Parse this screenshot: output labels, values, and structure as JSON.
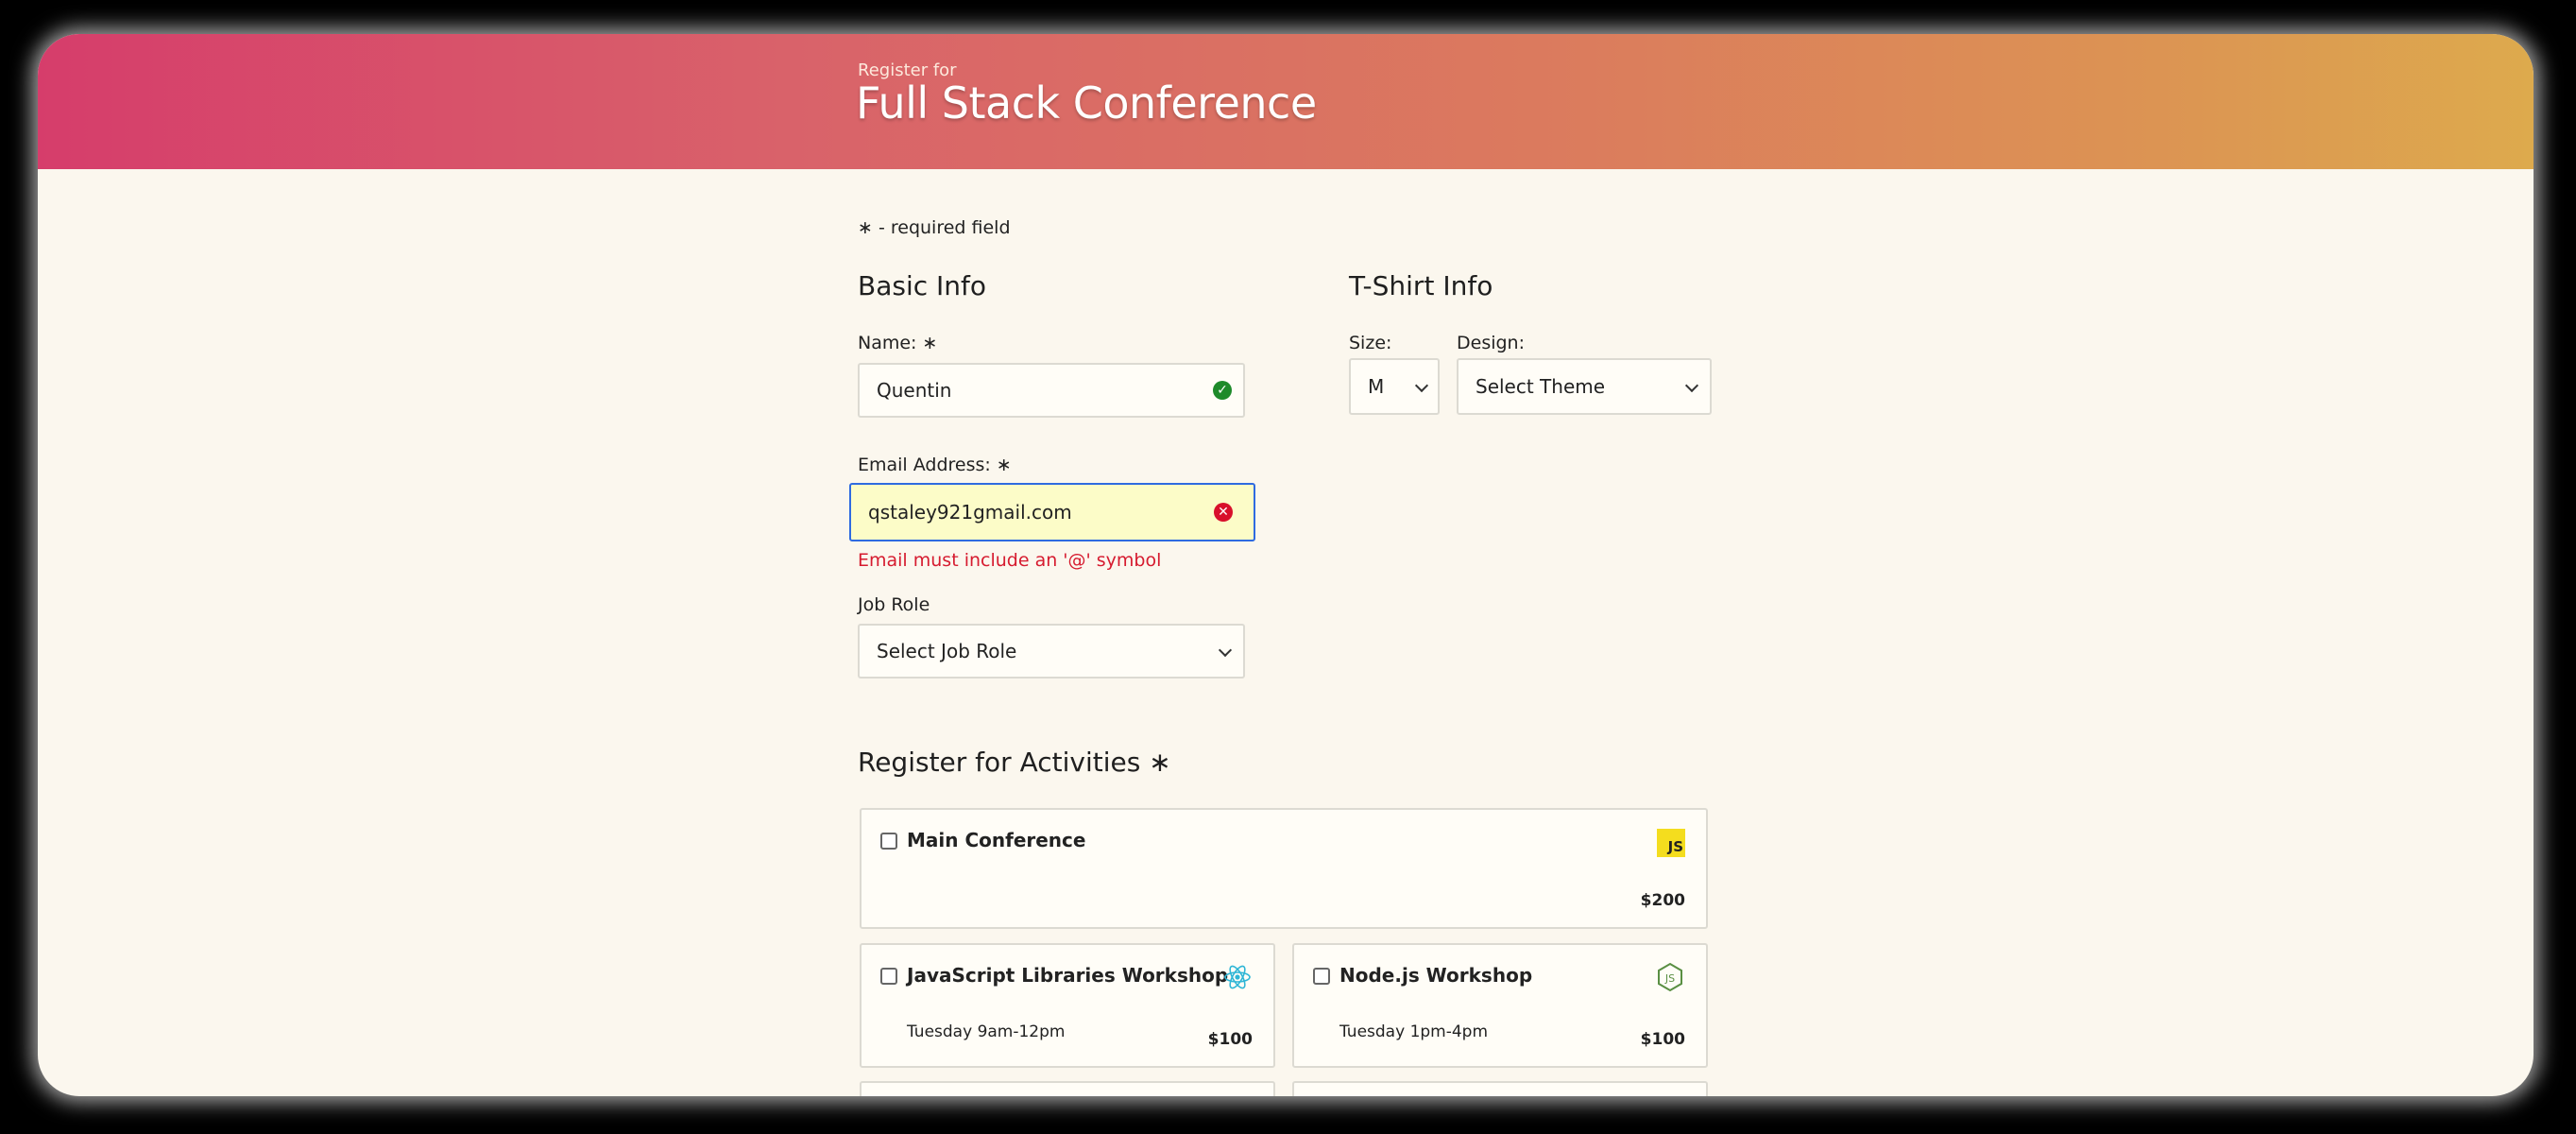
{
  "header": {
    "pretitle": "Register for",
    "title": "Full Stack Conference"
  },
  "required_note": "∗ - required field",
  "basic_info": {
    "title": "Basic Info",
    "name_label": "Name: ∗",
    "name_value": "Quentin",
    "email_label": "Email Address: ∗",
    "email_value": "qstaley921gmail.com",
    "email_error": "Email must include an '@' symbol",
    "job_role_label": "Job Role",
    "job_role_value": "Select Job Role"
  },
  "tshirt": {
    "title": "T-Shirt Info",
    "size_label": "Size:",
    "size_value": "M",
    "design_label": "Design:",
    "design_value": "Select Theme"
  },
  "activities": {
    "title": "Register for Activities ∗",
    "items": [
      {
        "name": "Main Conference",
        "time": "",
        "price": "$200",
        "icon": "javascript-icon"
      },
      {
        "name": "JavaScript Libraries Workshop",
        "time": "Tuesday 9am-12pm",
        "price": "$100",
        "icon": "react-icon"
      },
      {
        "name": "Node.js Workshop",
        "time": "Tuesday 1pm-4pm",
        "price": "$100",
        "icon": "nodejs-icon"
      }
    ]
  },
  "colors": {
    "header_gradient_start": "#d63d6b",
    "header_gradient_end": "#ddaa4d",
    "valid": "#1e8a2a",
    "error": "#d61b2f",
    "focus_border": "#2f6be0"
  }
}
